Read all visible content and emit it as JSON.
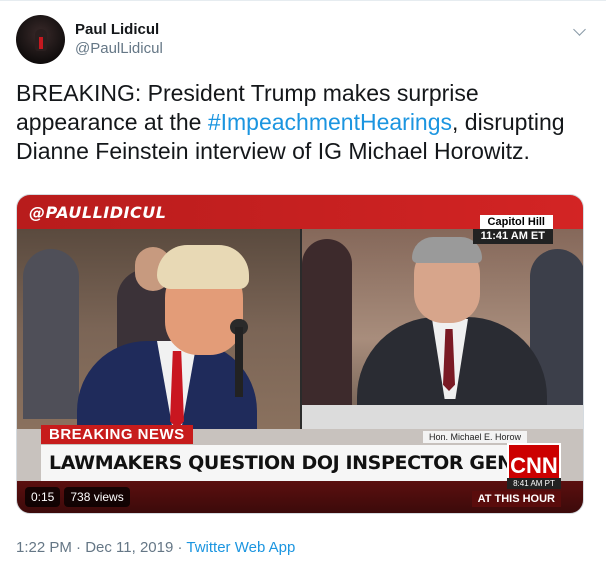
{
  "author": {
    "name": "Paul Lidicul",
    "handle": "@PaulLidicul"
  },
  "tweet": {
    "text_before": "BREAKING: President Trump makes surprise appearance at the ",
    "hashtag": "#ImpeachmentHearings",
    "text_after": ", disrupting Dianne Feinstein interview of IG Michael Horowitz."
  },
  "video": {
    "watermark": "@PAULLIDICUL",
    "location": "Capitol Hill",
    "time": "11:41 AM ET",
    "breaking_label": "BREAKING NEWS",
    "nameplate": "Hon. Michael E. Horow",
    "chyron": "LAWMAKERS QUESTION DOJ INSPECTOR GENERAL ON RUSSIA PROBE",
    "network": "CNN",
    "network_time": "8:41 AM PT",
    "show": "AT THIS HOUR",
    "duration": "0:15",
    "views": "738 views"
  },
  "footer": {
    "timestamp": "1:22 PM · Dec 11, 2019 · ",
    "source": "Twitter Web App"
  },
  "colors": {
    "link": "#1b95e0",
    "cnn_red": "#cc0000",
    "secondary_text": "#657786"
  }
}
